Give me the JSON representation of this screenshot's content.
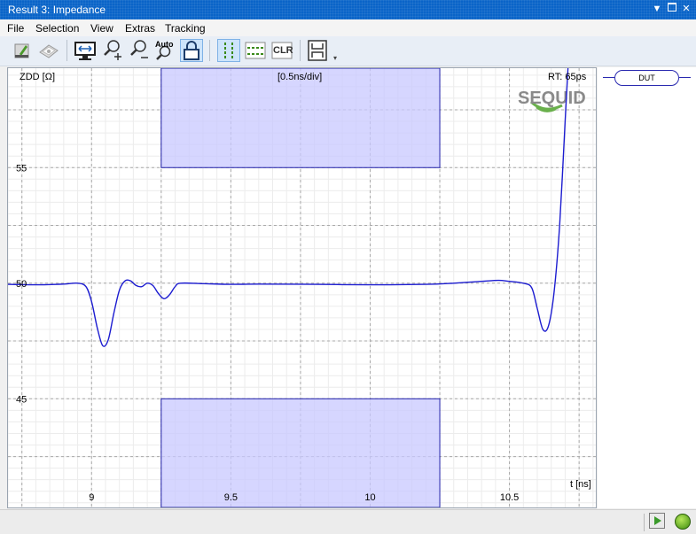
{
  "window": {
    "title": "Result 3: Impedance"
  },
  "menu": [
    "File",
    "Selection",
    "View",
    "Extras",
    "Tracking"
  ],
  "toolbar": {
    "auto_label": "Auto",
    "clr_label": "CLR"
  },
  "plot": {
    "y_unit_label": "ZDD [Ω]",
    "div_label": "[0.5ns/div]",
    "rt_label": "RT: 65ps",
    "x_unit_label": "t [ns]",
    "logo_text": "SEQUID"
  },
  "dut_label": "DUT",
  "chart_data": {
    "type": "line",
    "title": "",
    "xlabel": "t [ns]",
    "ylabel": "ZDD [Ω]",
    "x_ticks": [
      9,
      9.5,
      10,
      10.5
    ],
    "y_ticks": [
      45,
      50,
      55
    ],
    "xlim": [
      8.7,
      10.81
    ],
    "ylim": [
      40.3,
      59.3
    ],
    "grid": true,
    "series_color": "#1c1cd0",
    "mask_color": "#c8c8ff",
    "masks": [
      {
        "x": [
          9.25,
          10.25
        ],
        "y": [
          55,
          59.3
        ]
      },
      {
        "x": [
          9.25,
          10.25
        ],
        "y": [
          40.3,
          45
        ]
      }
    ],
    "series": [
      {
        "points": [
          [
            8.7,
            49.95
          ],
          [
            8.8,
            49.93
          ],
          [
            8.9,
            49.96
          ],
          [
            8.95,
            50.0
          ],
          [
            8.98,
            49.85
          ],
          [
            9.0,
            49.2
          ],
          [
            9.02,
            48.1
          ],
          [
            9.04,
            47.3
          ],
          [
            9.06,
            47.55
          ],
          [
            9.08,
            48.7
          ],
          [
            9.1,
            49.7
          ],
          [
            9.12,
            50.1
          ],
          [
            9.14,
            50.1
          ],
          [
            9.16,
            49.9
          ],
          [
            9.18,
            49.85
          ],
          [
            9.2,
            50.0
          ],
          [
            9.22,
            49.9
          ],
          [
            9.24,
            49.55
          ],
          [
            9.26,
            49.33
          ],
          [
            9.28,
            49.5
          ],
          [
            9.3,
            49.85
          ],
          [
            9.32,
            50.0
          ],
          [
            9.4,
            49.98
          ],
          [
            9.5,
            49.95
          ],
          [
            9.6,
            49.96
          ],
          [
            9.8,
            49.95
          ],
          [
            10.0,
            49.93
          ],
          [
            10.2,
            49.95
          ],
          [
            10.3,
            50.0
          ],
          [
            10.4,
            50.08
          ],
          [
            10.46,
            50.12
          ],
          [
            10.5,
            50.08
          ],
          [
            10.55,
            50.0
          ],
          [
            10.58,
            49.8
          ],
          [
            10.6,
            48.9
          ],
          [
            10.62,
            48.0
          ],
          [
            10.64,
            48.15
          ],
          [
            10.66,
            49.6
          ],
          [
            10.68,
            52.5
          ],
          [
            10.7,
            57.0
          ],
          [
            10.71,
            59.3
          ]
        ]
      }
    ]
  }
}
